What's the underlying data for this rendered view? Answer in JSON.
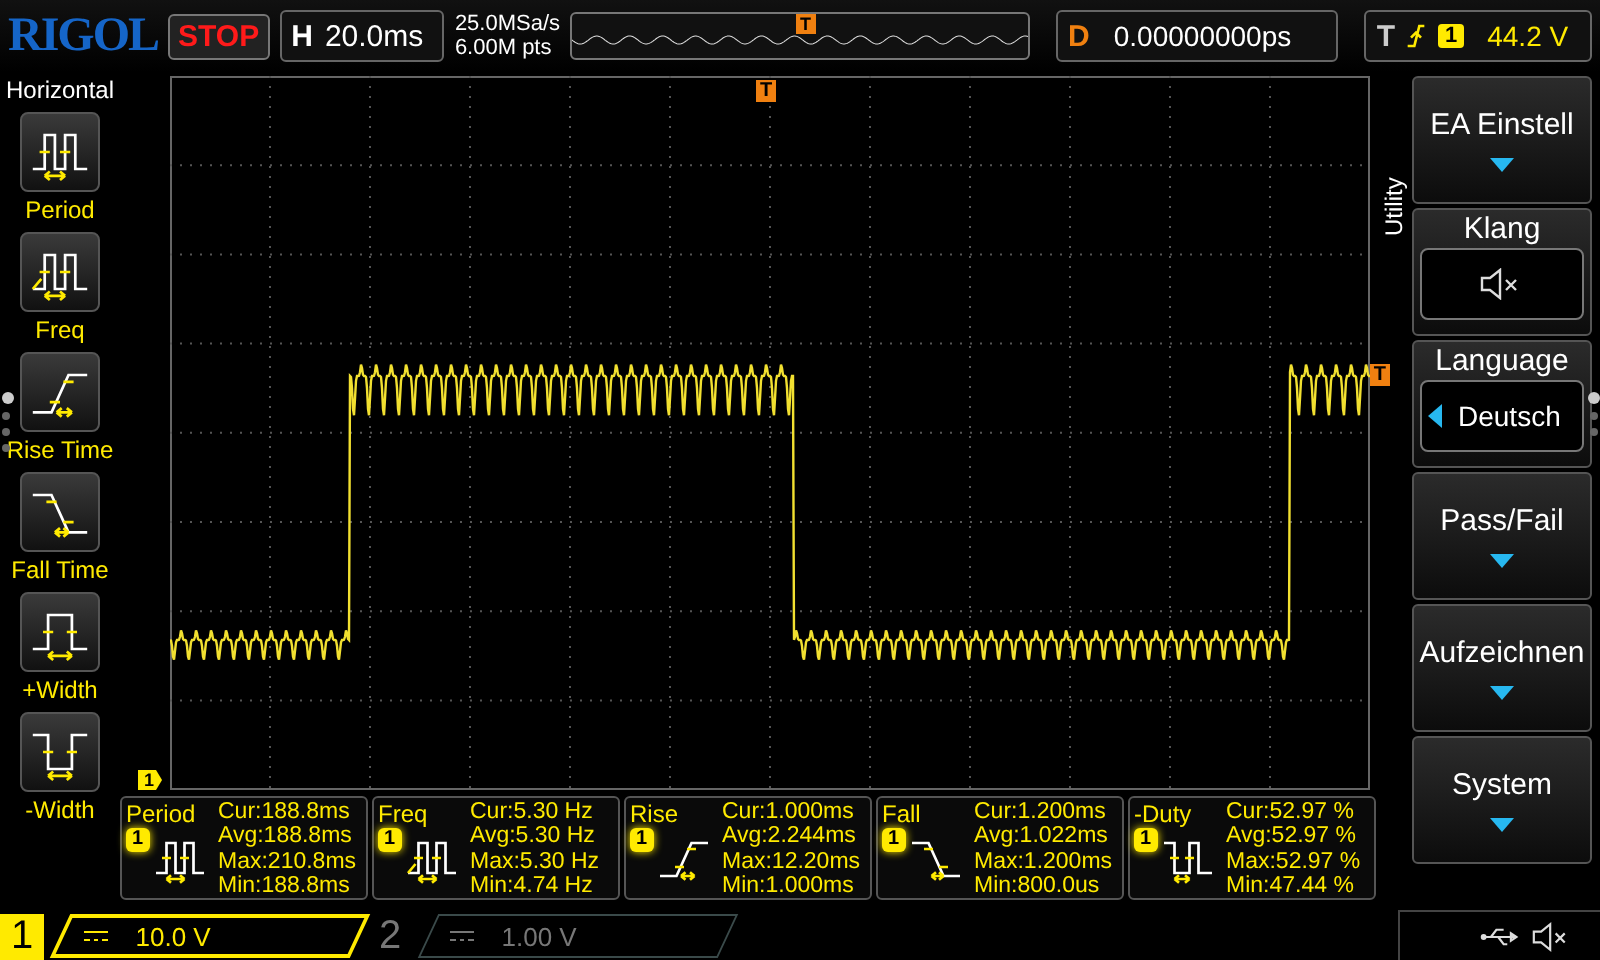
{
  "brand": "RIGOL",
  "run_state": "STOP",
  "timebase": {
    "label": "H",
    "value": "20.0ms"
  },
  "sample_rate": "25.0MSa/s",
  "memory_depth": "6.00M pts",
  "overview_trigger_marker": "T",
  "delay": {
    "label": "D",
    "value": "0.00000000ps"
  },
  "trigger": {
    "label": "T",
    "source": "1",
    "level": "44.2 V"
  },
  "screen": {
    "trigger_position_marker": "T",
    "trigger_level_marker": "T",
    "channel_marker": "1"
  },
  "left_menu": {
    "title": "Horizontal",
    "items": [
      {
        "label": "Period",
        "kind": "period"
      },
      {
        "label": "Freq",
        "kind": "freq"
      },
      {
        "label": "Rise Time",
        "kind": "rise"
      },
      {
        "label": "Fall Time",
        "kind": "fall"
      },
      {
        "label": "+Width",
        "kind": "pwidth"
      },
      {
        "label": "-Width",
        "kind": "nwidth"
      }
    ]
  },
  "right_menu": {
    "title": "Utility",
    "items": [
      {
        "label": "EA Einstell",
        "kind": "dropdown"
      },
      {
        "label": "Klang",
        "kind": "sound",
        "muted": true
      },
      {
        "label": "Language",
        "kind": "select",
        "value": "Deutsch"
      },
      {
        "label": "Pass/Fail",
        "kind": "dropdown"
      },
      {
        "label": "Aufzeichnen",
        "kind": "dropdown"
      },
      {
        "label": "System",
        "kind": "dropdown"
      }
    ]
  },
  "measurements": [
    {
      "name": "Period",
      "kind": "period",
      "source": "1",
      "lines": [
        "Cur:188.8ms",
        "Avg:188.8ms",
        "Max:210.8ms",
        "Min:188.8ms"
      ]
    },
    {
      "name": "Freq",
      "kind": "freq",
      "source": "1",
      "lines": [
        "Cur:5.30 Hz",
        "Avg:5.30 Hz",
        "Max:5.30 Hz",
        "Min:4.74 Hz"
      ]
    },
    {
      "name": "Rise",
      "kind": "rise",
      "source": "1",
      "lines": [
        "Cur:1.000ms",
        "Avg:2.244ms",
        "Max:12.20ms",
        "Min:1.000ms"
      ]
    },
    {
      "name": "Fall",
      "kind": "fall",
      "source": "1",
      "lines": [
        "Cur:1.200ms",
        "Avg:1.022ms",
        "Max:1.200ms",
        "Min:800.0us"
      ]
    },
    {
      "name": "-Duty",
      "kind": "nduty",
      "source": "1",
      "lines": [
        "Cur:52.97 %",
        "Avg:52.97 %",
        "Max:52.97 %",
        "Min:47.44 %"
      ]
    }
  ],
  "channels": [
    {
      "number": "1",
      "scale": "10.0 V",
      "enabled": true
    },
    {
      "number": "2",
      "scale": "1.00 V",
      "enabled": false
    }
  ]
}
